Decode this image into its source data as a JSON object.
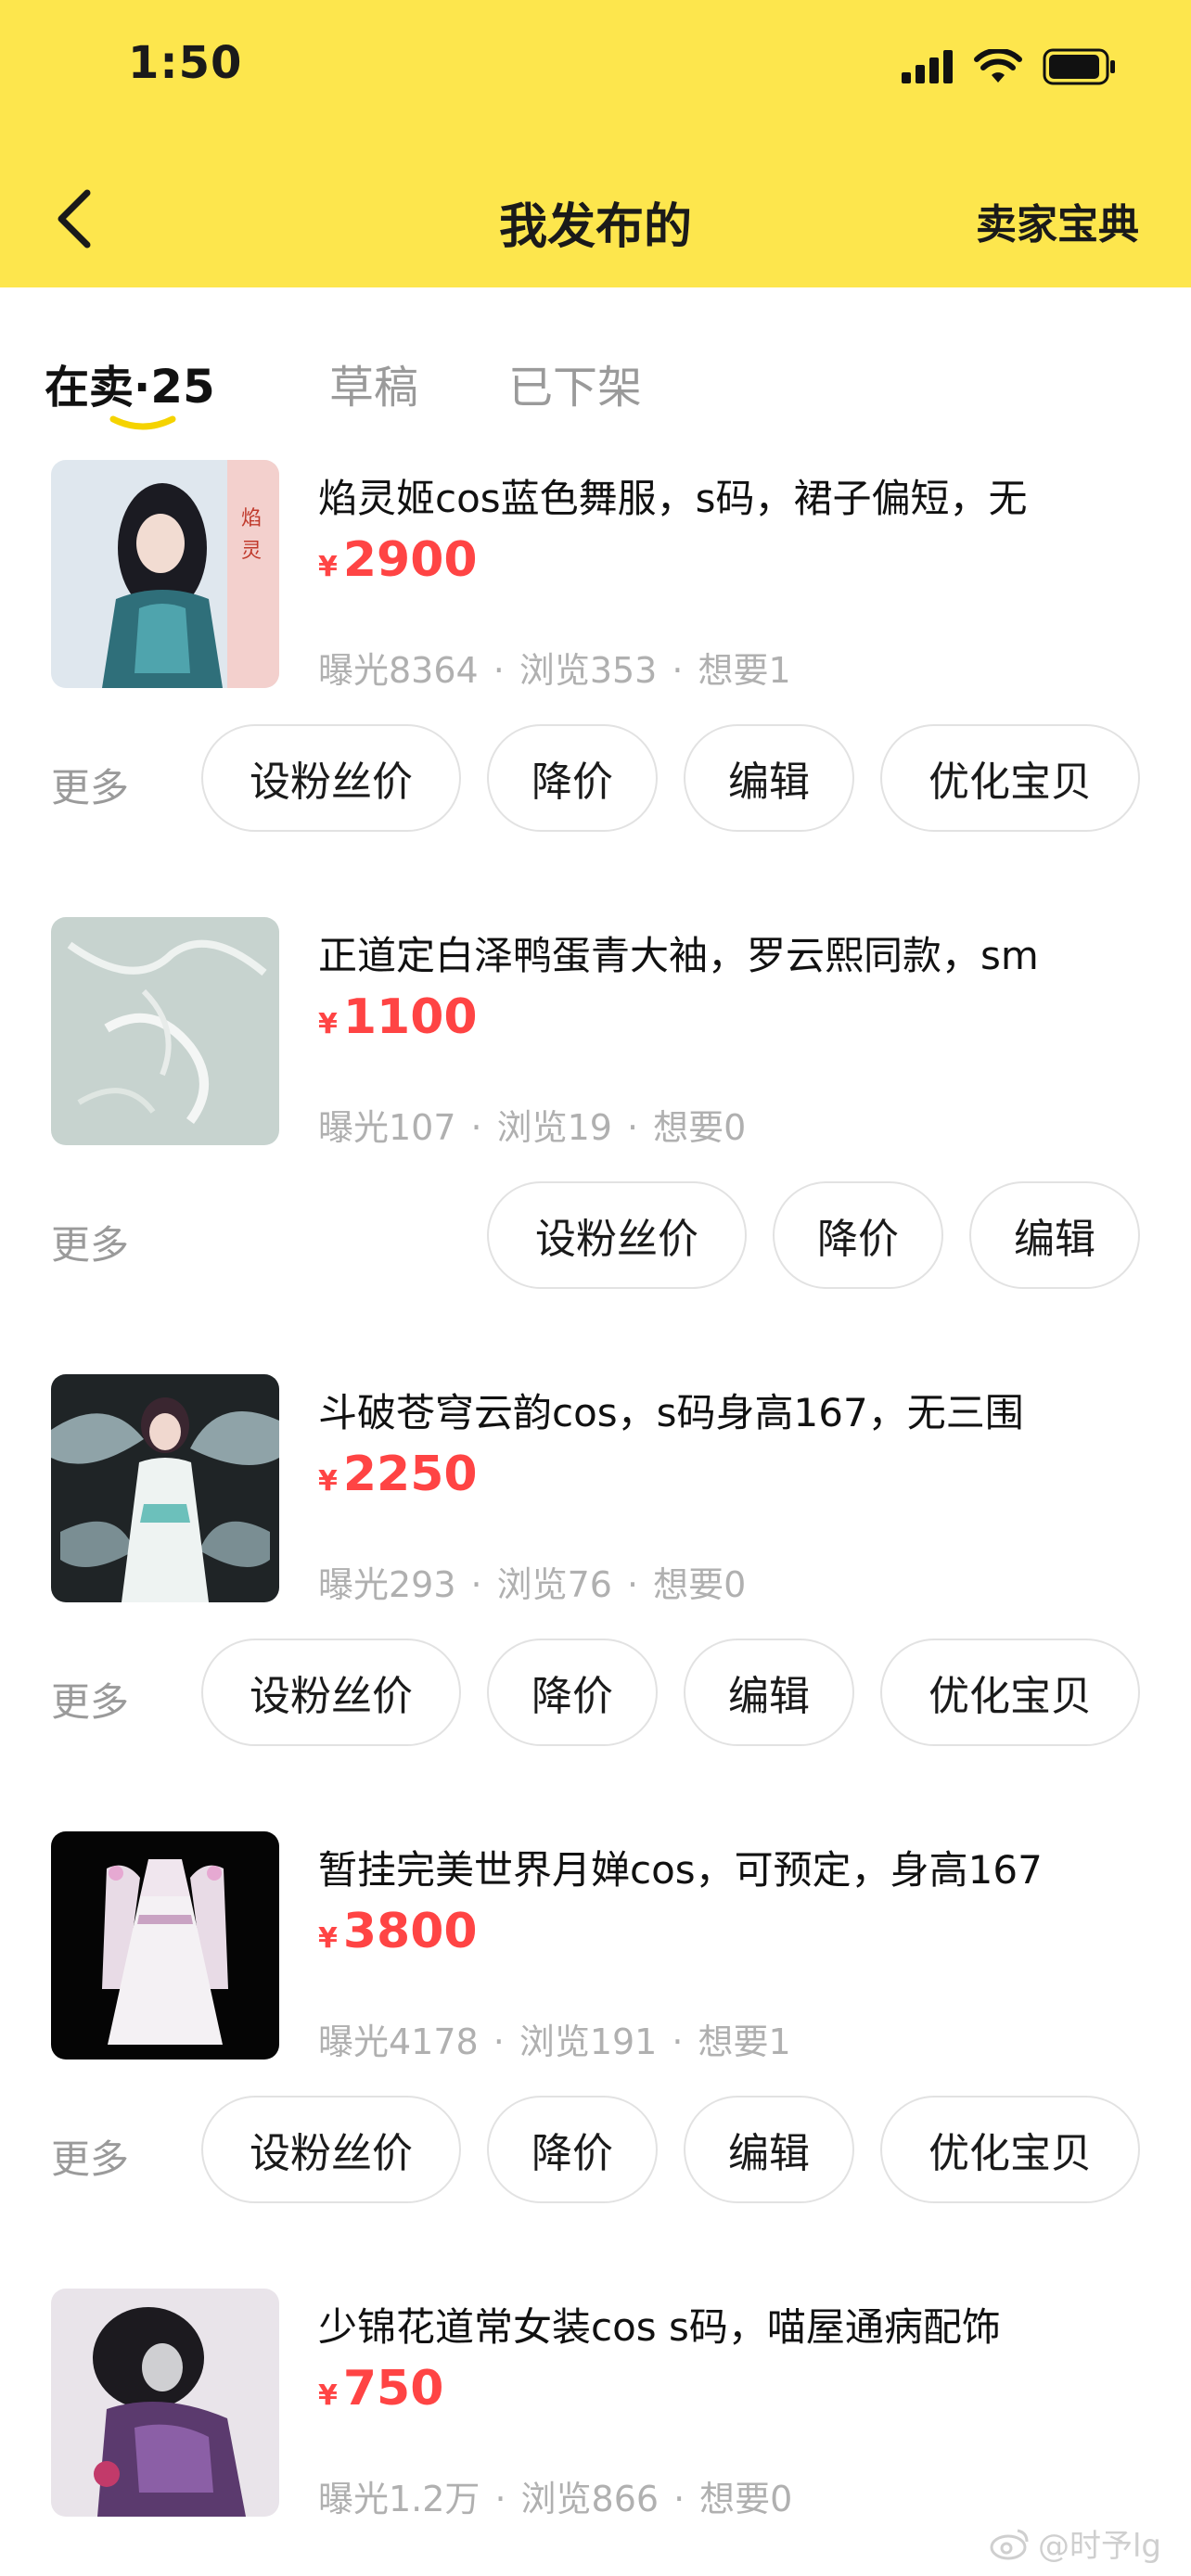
{
  "status_bar": {
    "time": "1:50"
  },
  "nav": {
    "title": "我发布的",
    "right_label": "卖家宝典"
  },
  "tabs": {
    "active": {
      "label": "在卖",
      "separator": "·",
      "count": "25"
    },
    "draft": "草稿",
    "off_shelf": "已下架"
  },
  "items": [
    {
      "title": "焰灵姬cos蓝色舞服，s码，裙子偏短，无",
      "currency": "¥",
      "price": "2900",
      "exposure": "曝光8364",
      "views": "浏览353",
      "wants": "想要1",
      "more": "更多",
      "buttons": {
        "fans_price": "设粉丝价",
        "price_cut": "降价",
        "edit": "编辑",
        "optimize": "优化宝贝"
      }
    },
    {
      "title": "正道定白泽鸭蛋青大袖，罗云熙同款，sm",
      "currency": "¥",
      "price": "1100",
      "exposure": "曝光107",
      "views": "浏览19",
      "wants": "想要0",
      "more": "更多",
      "buttons": {
        "fans_price": "设粉丝价",
        "price_cut": "降价",
        "edit": "编辑"
      }
    },
    {
      "title": "斗破苍穹云韵cos，s码身高167，无三围",
      "currency": "¥",
      "price": "2250",
      "exposure": "曝光293",
      "views": "浏览76",
      "wants": "想要0",
      "more": "更多",
      "buttons": {
        "fans_price": "设粉丝价",
        "price_cut": "降价",
        "edit": "编辑",
        "optimize": "优化宝贝"
      }
    },
    {
      "title": "暂挂完美世界月婵cos，可预定，身高167",
      "currency": "¥",
      "price": "3800",
      "exposure": "曝光4178",
      "views": "浏览191",
      "wants": "想要1",
      "more": "更多",
      "buttons": {
        "fans_price": "设粉丝价",
        "price_cut": "降价",
        "edit": "编辑",
        "optimize": "优化宝贝"
      }
    },
    {
      "title": "少锦花道常女装cos s码，喵屋通病配饰",
      "currency": "¥",
      "price": "750",
      "exposure": "曝光1.2万",
      "views": "浏览866",
      "wants": "想要0"
    }
  ],
  "stats_separator": "·",
  "watermark": "@时予lg",
  "colors": {
    "header_bg": "#fde64d",
    "price": "#ff4444",
    "muted": "#9a9a9a",
    "stats": "#b0b0b0",
    "tab_underline": "#f5d300"
  }
}
